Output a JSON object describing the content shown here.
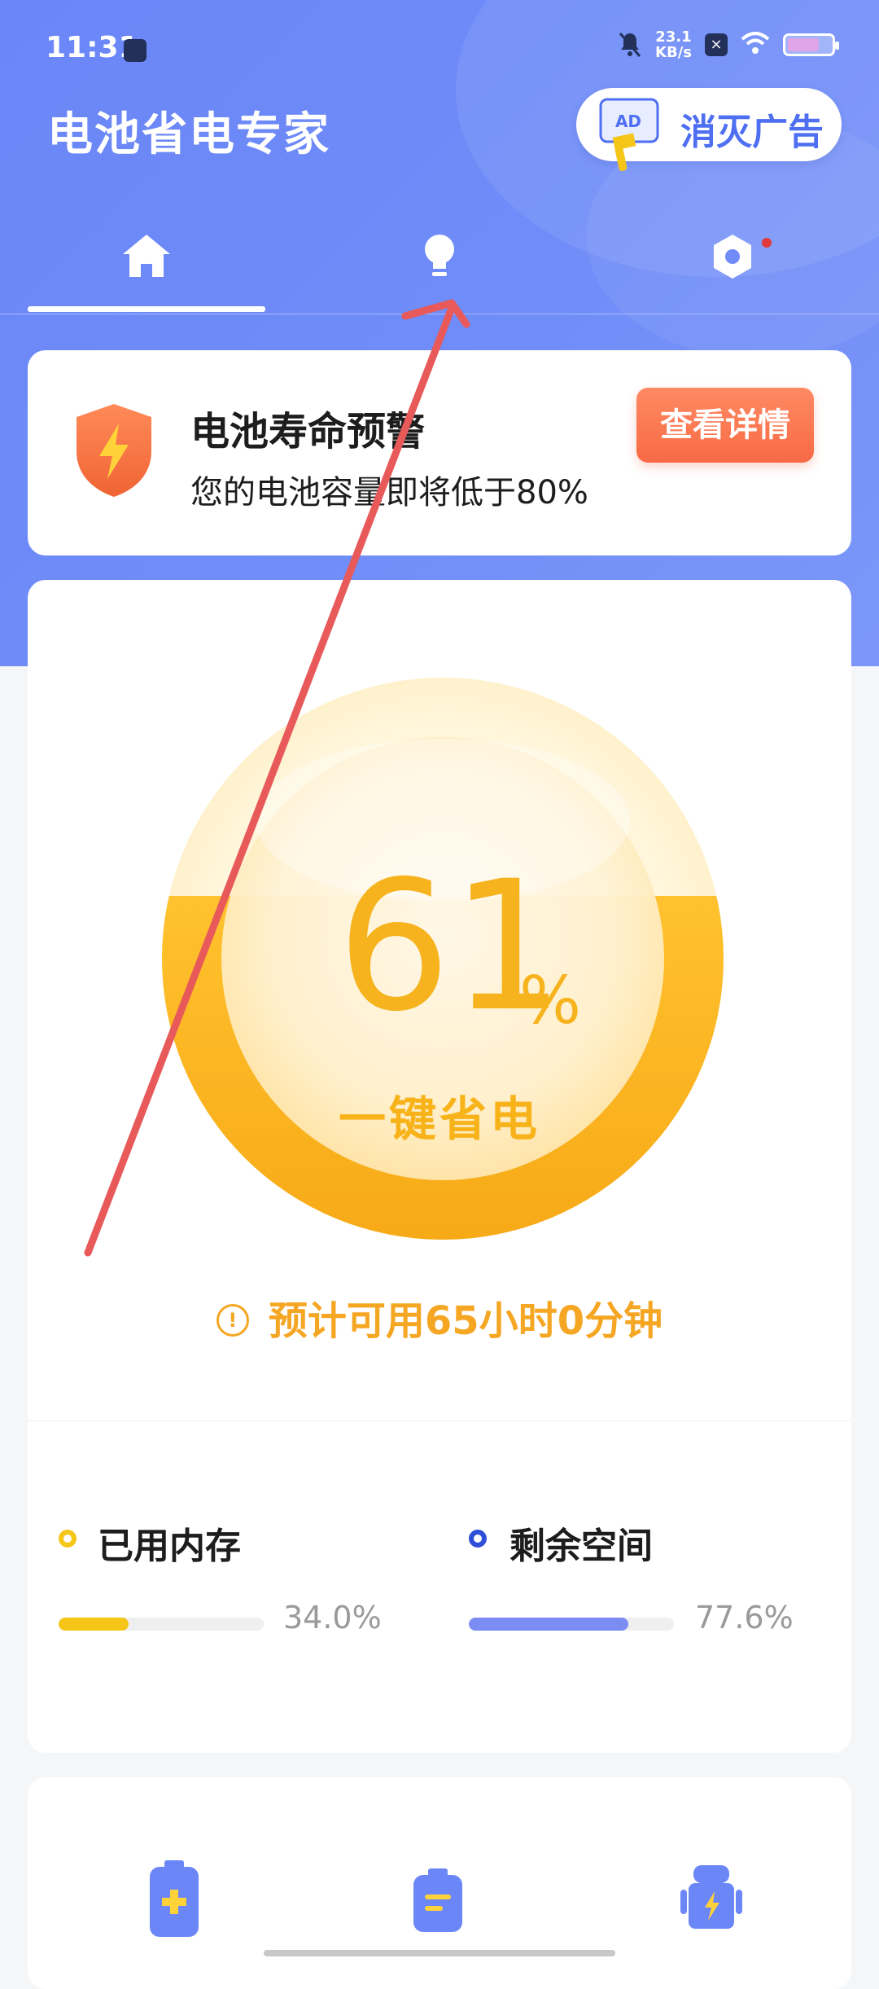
{
  "status_bar": {
    "time": "11:31",
    "net_speed_value": "23.1",
    "net_speed_unit": "KB/s"
  },
  "header": {
    "title": "电池省电专家",
    "ad_button_label": "消灭广告",
    "ad_icon_text": "AD",
    "tabs": [
      "home",
      "bulb",
      "settings"
    ],
    "active_tab": "home"
  },
  "warning": {
    "title": "电池寿命预警",
    "description": "您的电池容量即将低于80%",
    "button_label": "查看详情"
  },
  "battery": {
    "percent": "61",
    "percent_sign": "%",
    "level": 0.61,
    "action_label": "一键省电",
    "estimate_icon": "!",
    "estimate": "预计可用65小时0分钟"
  },
  "stats": [
    {
      "label": "已用内存",
      "value": "34.0%",
      "fraction": 0.34,
      "color": "#f5c518"
    },
    {
      "label": "剩余空间",
      "value": "77.6%",
      "fraction": 0.776,
      "color": "#7b8cf2"
    }
  ],
  "tools": [
    "battery-charge-icon",
    "battery-list-icon",
    "android-battery-icon"
  ],
  "colors": {
    "header_blue": "#6f8cf8",
    "accent_orange": "#f76a45",
    "battery_yellow": "#f6b31d",
    "annotation_red": "#e85a5a"
  }
}
